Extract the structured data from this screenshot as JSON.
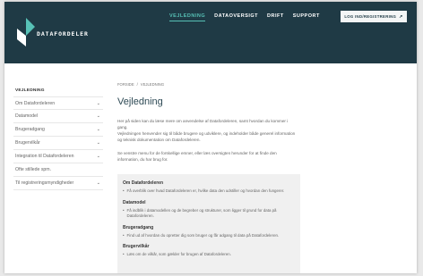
{
  "brand": {
    "name": "DATAFORDELER"
  },
  "nav": {
    "items": [
      {
        "label": "VEJLEDNING",
        "active": true
      },
      {
        "label": "DATAOVERSIGT",
        "active": false
      },
      {
        "label": "DRIFT",
        "active": false
      },
      {
        "label": "SUPPORT",
        "active": false
      }
    ],
    "login_label": "LOG IND/REGISTRERING",
    "login_icon": "external-link-icon"
  },
  "sidebar": {
    "title": "VEJLEDNING",
    "items": [
      {
        "label": "Om Datafordeleren"
      },
      {
        "label": "Datamodel"
      },
      {
        "label": "Brugeradgang"
      },
      {
        "label": "Brugervilkår"
      },
      {
        "label": "Integration til Datafordeleren"
      },
      {
        "label": "Ofte stillede spm."
      },
      {
        "label": "Til registreringsmyndigheder"
      }
    ]
  },
  "main": {
    "breadcrumb": {
      "home": "FORSIDE",
      "separator": "/",
      "current": "VEJLEDNING"
    },
    "title": "Vejledning",
    "paragraphs": [
      "Her på siden kan du læse mere om anvendelse af Datafordeleren, samt hvordan du kommer i gang.",
      "Vejledningen henvender sig til både brugere og udviklere, og indeholder både generel information og teknisk dokumentation om Datafordeleren.",
      "Se venstre menu for de forskellige emner, eller læs oversigten herunder for at finde den information, du har brug for."
    ],
    "sections": [
      {
        "title": "Om Datafordeleren",
        "text": "Få overblik over hvad Datafordeleren er, hvilke data den udstiller og hvordan den fungerer."
      },
      {
        "title": "Datamodel",
        "text": "Få indblik i datamodellen og de begreber og strukturer, som ligger til grund for data på Datafordeleren."
      },
      {
        "title": "Brugeradgang",
        "text": "Find ud af hvordan du opretter dig som bruger og får adgang til data på Datafordeleren."
      },
      {
        "title": "Brugervilkår",
        "text": "Læs om de vilkår, som gælder for brugen af Datafordeleren."
      }
    ]
  },
  "colors": {
    "header_bg": "#1f3a45",
    "accent": "#57c1b6",
    "infobox_bg": "#f0f0f0"
  }
}
